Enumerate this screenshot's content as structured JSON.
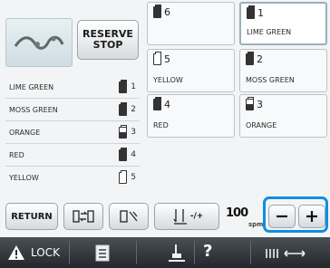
{
  "reserve_button": {
    "line1": "RESERVE",
    "line2": "STOP"
  },
  "color_list": [
    {
      "name": "LIME GREEN",
      "needle": "1",
      "spool": "full"
    },
    {
      "name": "MOSS GREEN",
      "needle": "2",
      "spool": "full"
    },
    {
      "name": "ORANGE",
      "needle": "3",
      "spool": "mid"
    },
    {
      "name": "RED",
      "needle": "4",
      "spool": "full"
    },
    {
      "name": "YELLOW",
      "needle": "5",
      "spool": "empty"
    }
  ],
  "needle_grid": [
    {
      "id": "6",
      "color": "",
      "spool": "full"
    },
    {
      "id": "1",
      "color": "LIME GREEN",
      "spool": "full",
      "selected": true
    },
    {
      "id": "5",
      "color": "YELLOW",
      "spool": "empty"
    },
    {
      "id": "2",
      "color": "MOSS GREEN",
      "spool": "full"
    },
    {
      "id": "4",
      "color": "RED",
      "spool": "full"
    },
    {
      "id": "3",
      "color": "ORANGE",
      "spool": "mid"
    }
  ],
  "buttons": {
    "return": "RETURN",
    "speed_adjust": "-/+"
  },
  "speed_display": {
    "value": "100",
    "unit": "spm"
  },
  "bottom_bar": {
    "lock_label": "LOCK",
    "help_glyph": "?"
  },
  "icons": {
    "lock": "lock-icon",
    "embroidery_preview": "embroidery-preview-icon",
    "thread": "spool-icon",
    "swap": "swap-needles-icon",
    "trim": "thread-trim-icon",
    "needle": "needle-icon",
    "minus": "minus-icon",
    "plus": "plus-icon"
  }
}
